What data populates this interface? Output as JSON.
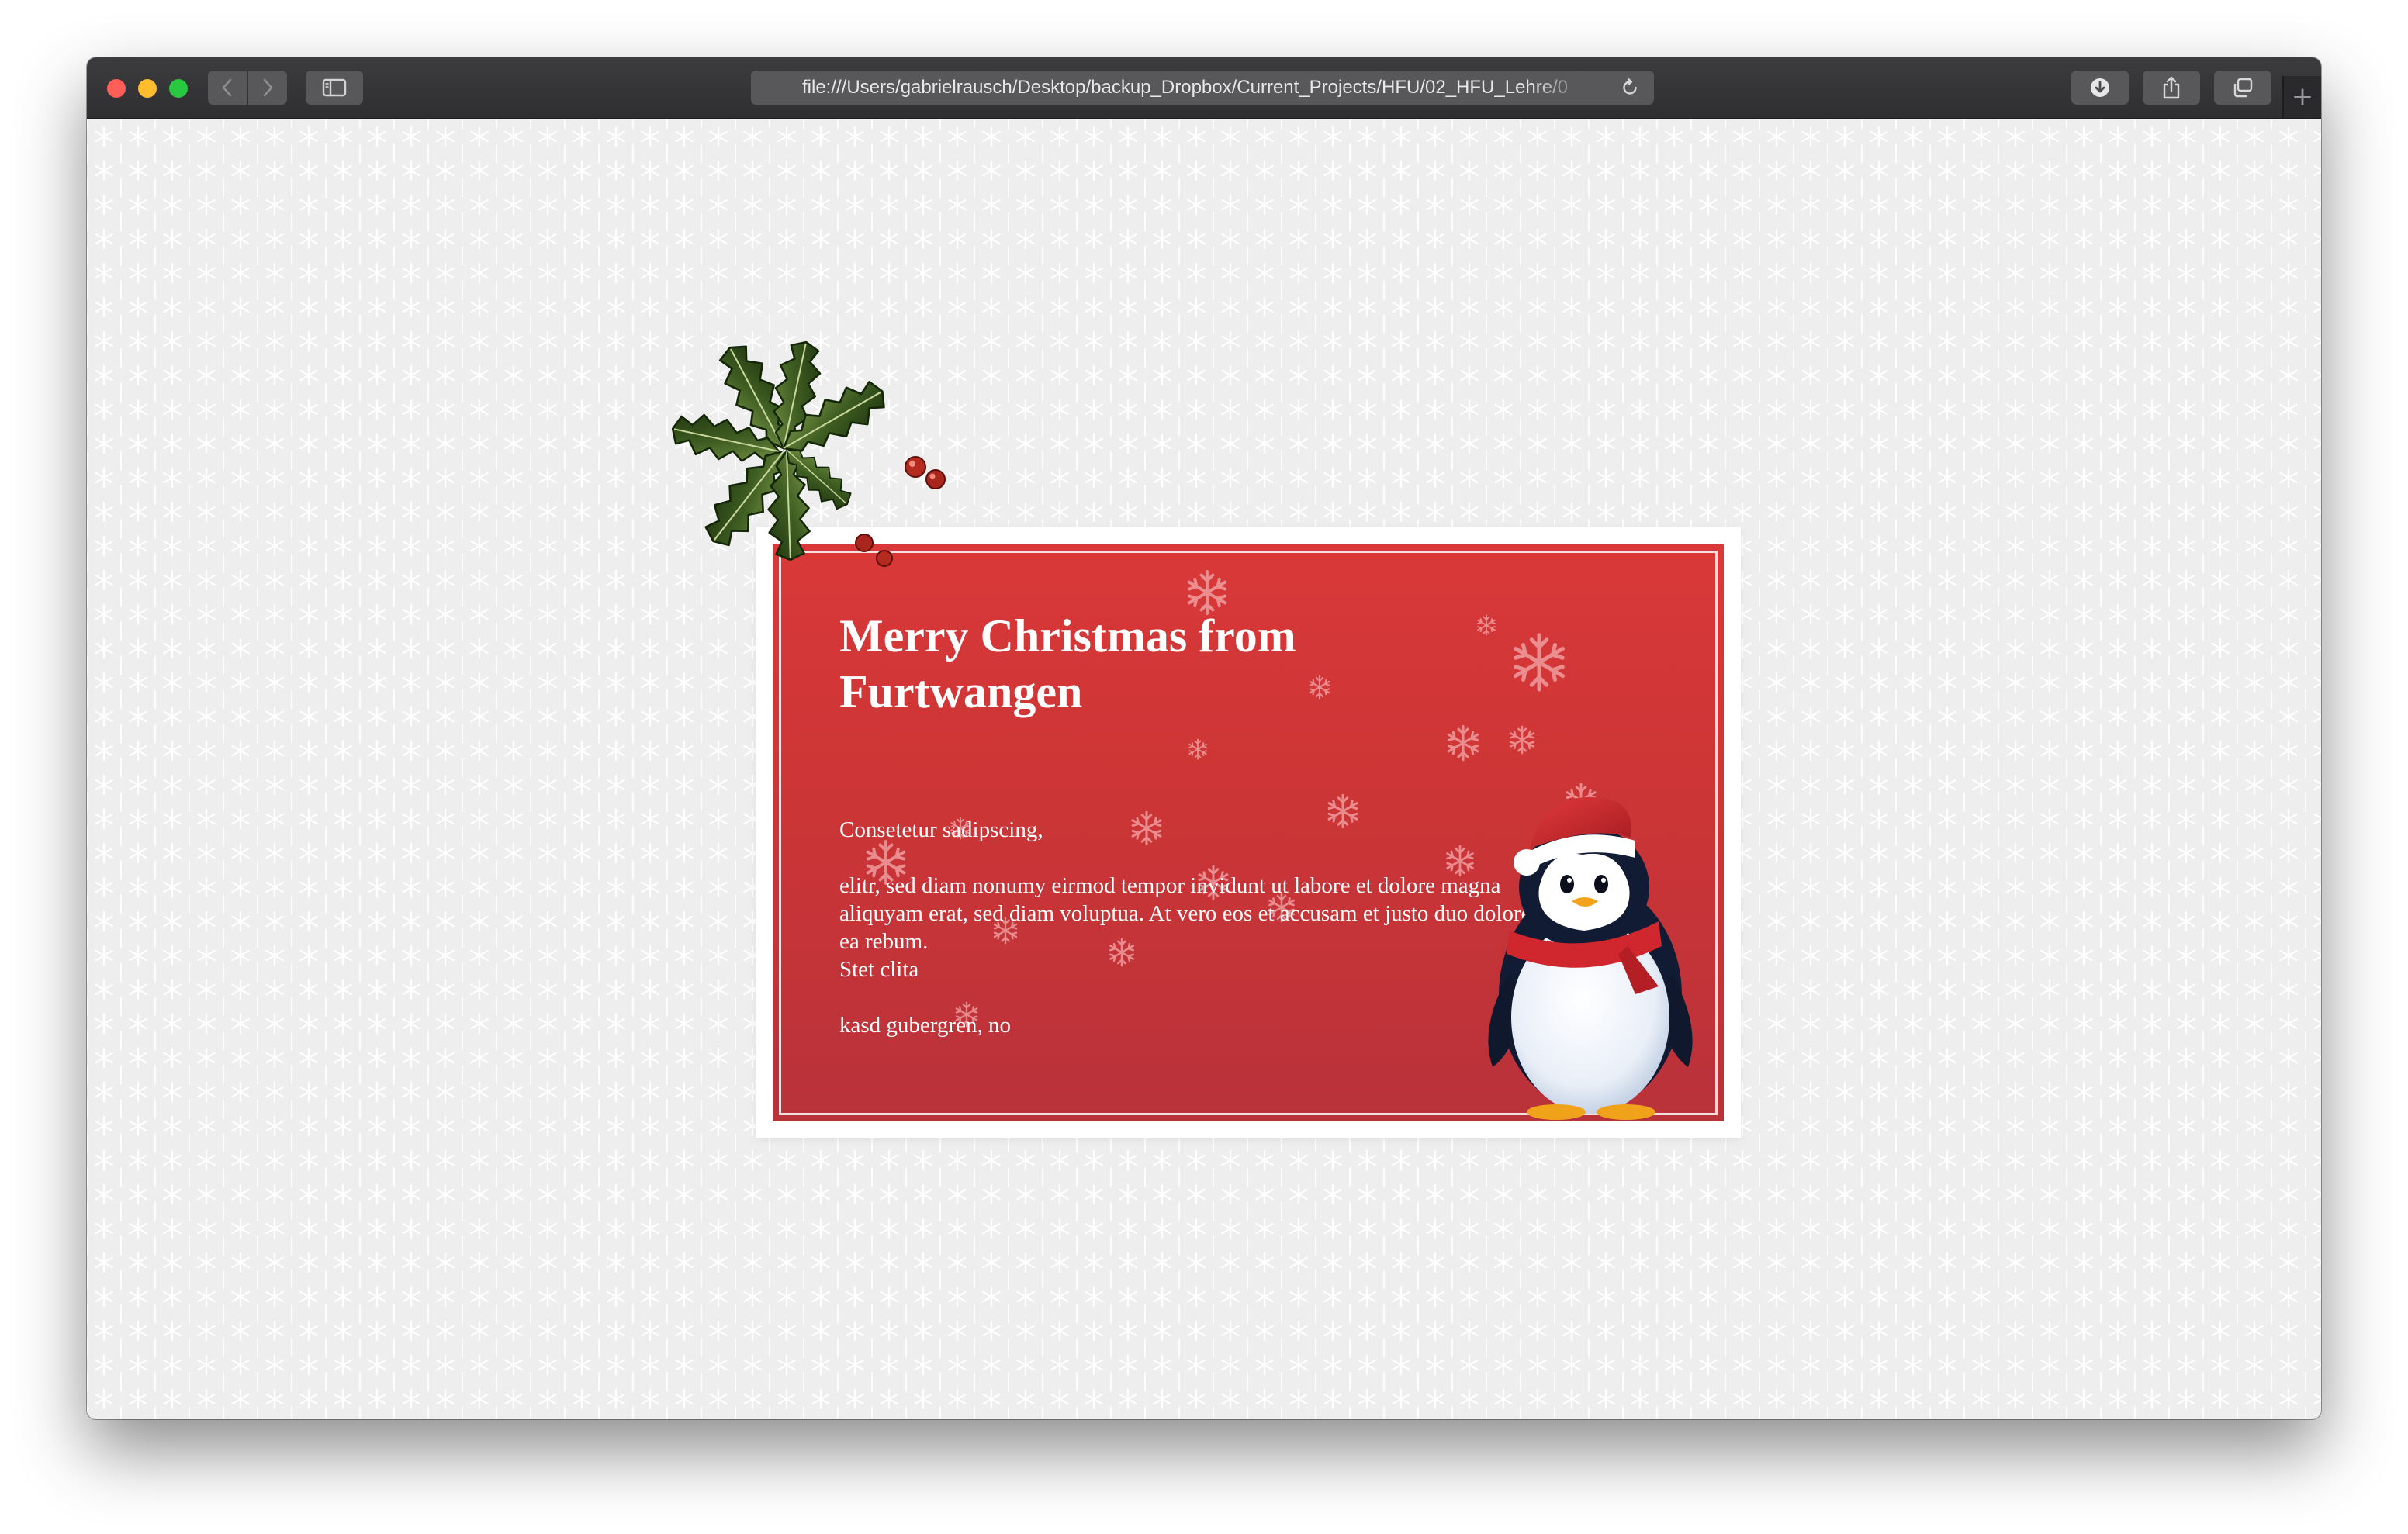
{
  "browser": {
    "url": "file:///Users/gabrielrausch/Desktop/backup_Dropbox/Current_Projects/HFU/02_HFU_Lehre/0",
    "new_tab_label": "+",
    "back_glyph": "‹",
    "forward_glyph": "›"
  },
  "card": {
    "title": "Merry Christmas from Furtwangen",
    "body": {
      "line1": "Consetetur sadipscing,",
      "paragraph": "elitr, sed diam nonumy eirmod tempor invidunt ut labore et dolore magna aliquyam erat, sed diam voluptua. At vero eos et accusam et justo duo dolores et ea rebum.",
      "line3": "Stet clita",
      "line4": "kasd gubergren, no"
    }
  },
  "colors": {
    "card_red_top": "#d93838",
    "card_red_bottom": "#b9323a",
    "page_background": "#eeeeee",
    "titlebar": "#3c3c3e"
  },
  "icons": {
    "close": "close-icon",
    "minimize": "minimize-icon",
    "zoom": "zoom-icon",
    "back": "chevron-left-icon",
    "forward": "chevron-right-icon",
    "sidebar": "sidebar-icon",
    "reload": "reload-icon",
    "download": "download-icon",
    "share": "share-icon",
    "tabs": "tabs-overview-icon"
  }
}
